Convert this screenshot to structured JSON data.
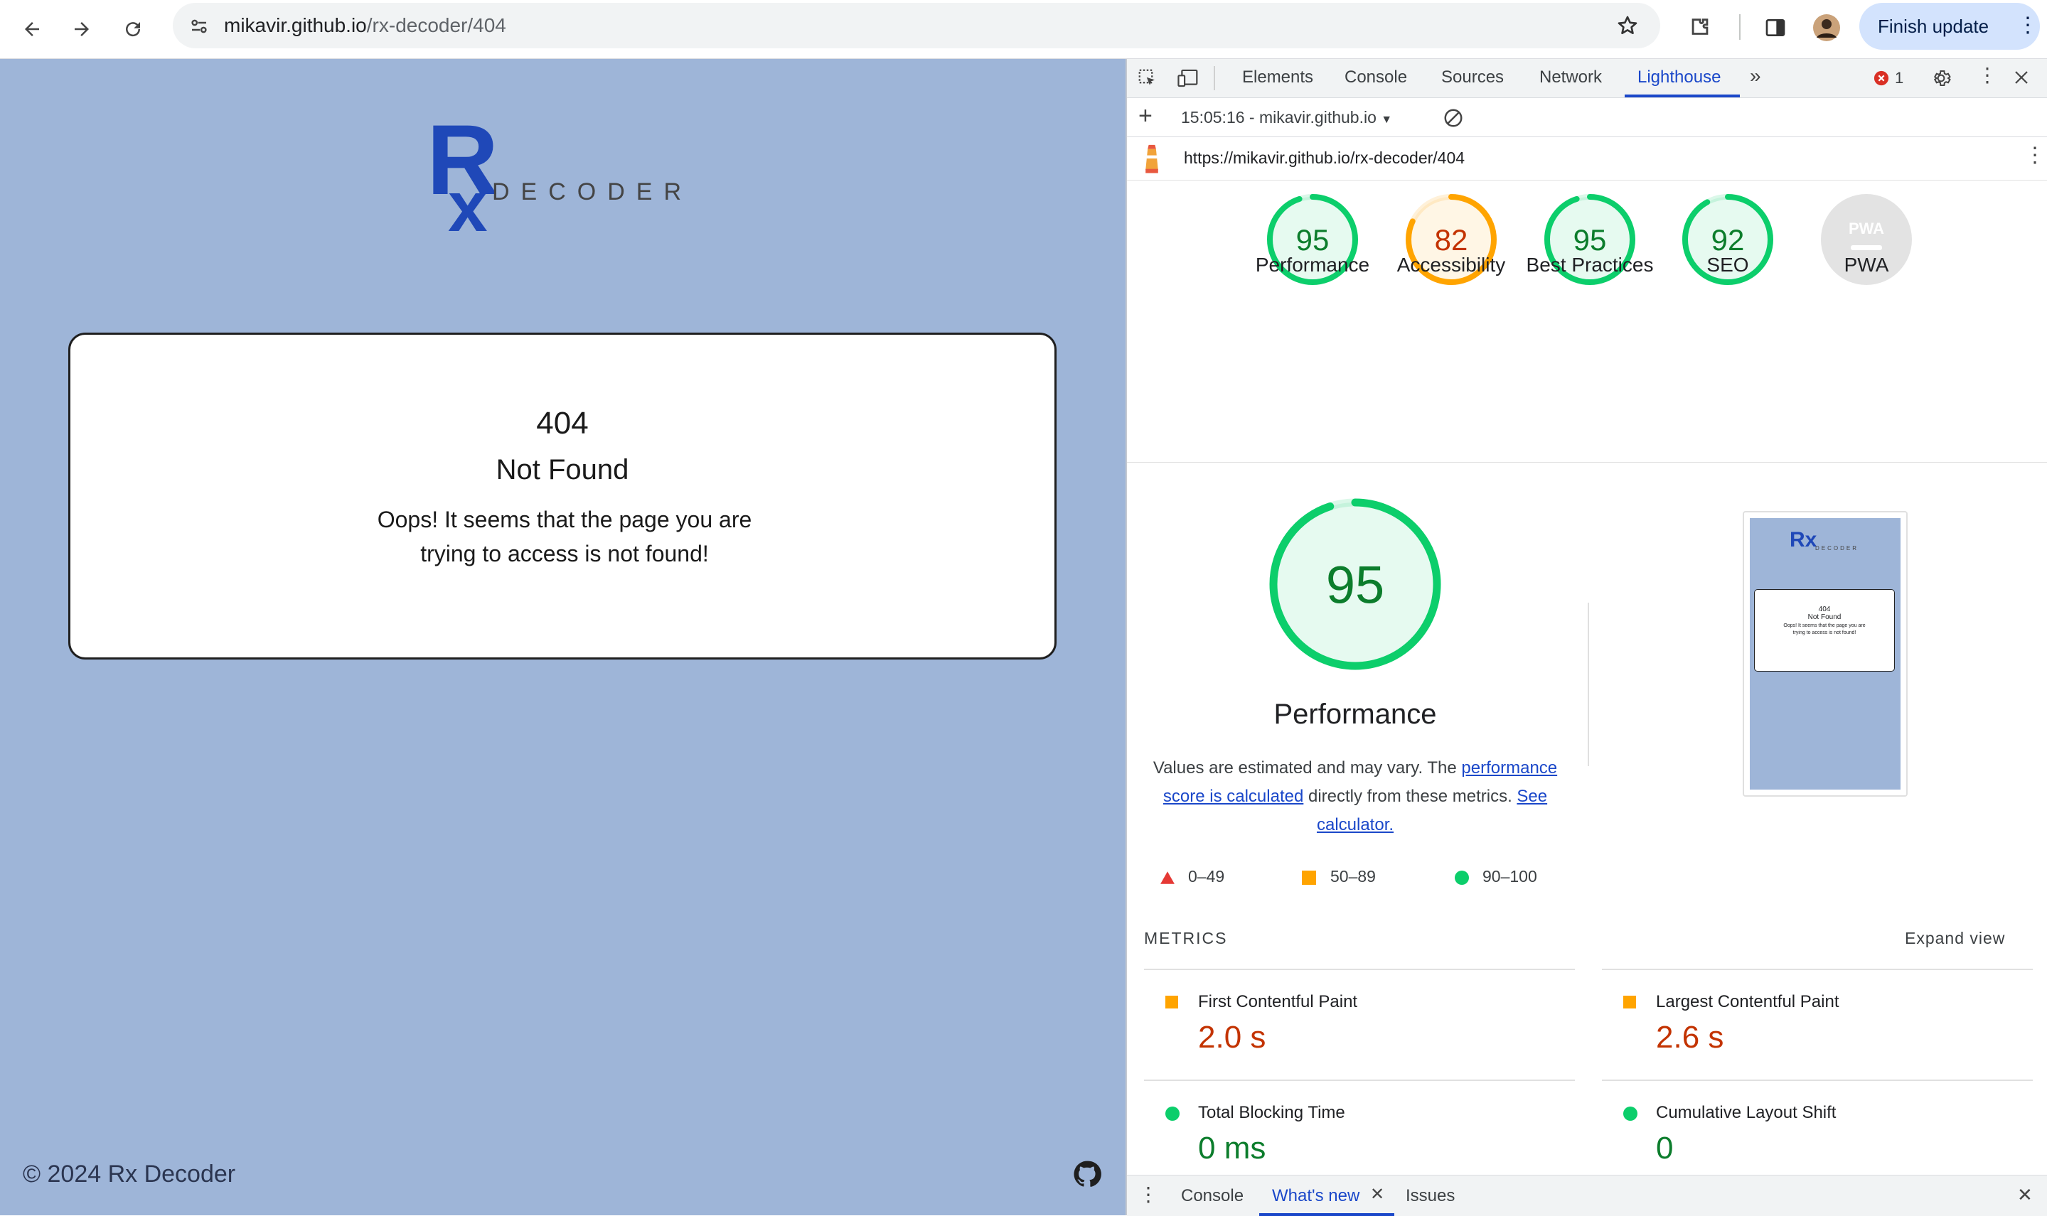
{
  "browser": {
    "url_host": "mikavir.github.io",
    "url_path": "/rx-decoder/404",
    "finish_update_label": "Finish update"
  },
  "page": {
    "logo_mark": "Rx",
    "logo_text": "DECODER",
    "error_code": "404",
    "error_title": "Not Found",
    "error_message": "Oops! It seems that the page you are trying to access is not found!",
    "footer": "© 2024 Rx Decoder",
    "colors": {
      "background": "#9eb5d8",
      "brand": "#1f48b8"
    }
  },
  "devtools": {
    "tabs": [
      "Elements",
      "Console",
      "Sources",
      "Network",
      "Lighthouse"
    ],
    "active_tab": "Lighthouse",
    "error_count": "1",
    "report_selector": "15:05:16 - mikavir.github.io",
    "report_url": "https://mikavir.github.io/rx-decoder/404",
    "scores": [
      {
        "label": "Performance",
        "value": "95",
        "color": "#0c7d2c",
        "ring": "#0cce6b"
      },
      {
        "label": "Accessibility",
        "value": "82",
        "color": "#c33300",
        "ring": "#ffa400"
      },
      {
        "label": "Best Practices",
        "value": "95",
        "color": "#0c7d2c",
        "ring": "#0cce6b"
      },
      {
        "label": "SEO",
        "value": "92",
        "color": "#0c7d2c",
        "ring": "#0cce6b"
      },
      {
        "label": "PWA",
        "value": "",
        "color": "#9e9e9e",
        "ring": "#cccccc"
      }
    ],
    "pwa_badge": "PWA",
    "main_score": {
      "value": "95",
      "label": "Performance"
    },
    "description": {
      "prefix": "Values are estimated and may vary. The ",
      "link1": "performance score is calculated",
      "middle": " directly from these metrics. ",
      "link2": "See calculator."
    },
    "legend": [
      {
        "range": "0–49",
        "color": "#e53935"
      },
      {
        "range": "50–89",
        "color": "#ffa400"
      },
      {
        "range": "90–100",
        "color": "#0cce6b"
      }
    ],
    "metrics_heading": "METRICS",
    "expand_view": "Expand view",
    "metrics": [
      {
        "name": "First Contentful Paint",
        "value": "2.0 s",
        "status": "average",
        "color": "#c33300"
      },
      {
        "name": "Largest Contentful Paint",
        "value": "2.6 s",
        "status": "average",
        "color": "#c33300"
      },
      {
        "name": "Total Blocking Time",
        "value": "0 ms",
        "status": "good",
        "color": "#0c7d2c"
      },
      {
        "name": "Cumulative Layout Shift",
        "value": "0",
        "status": "good",
        "color": "#0c7d2c"
      }
    ],
    "thumbnail": {
      "code": "404",
      "title": "Not Found",
      "message": "Oops! It seems that the page you are trying to access is not found!"
    },
    "drawer_tabs": [
      "Console",
      "What's new",
      "Issues"
    ],
    "drawer_active": "What's new"
  }
}
